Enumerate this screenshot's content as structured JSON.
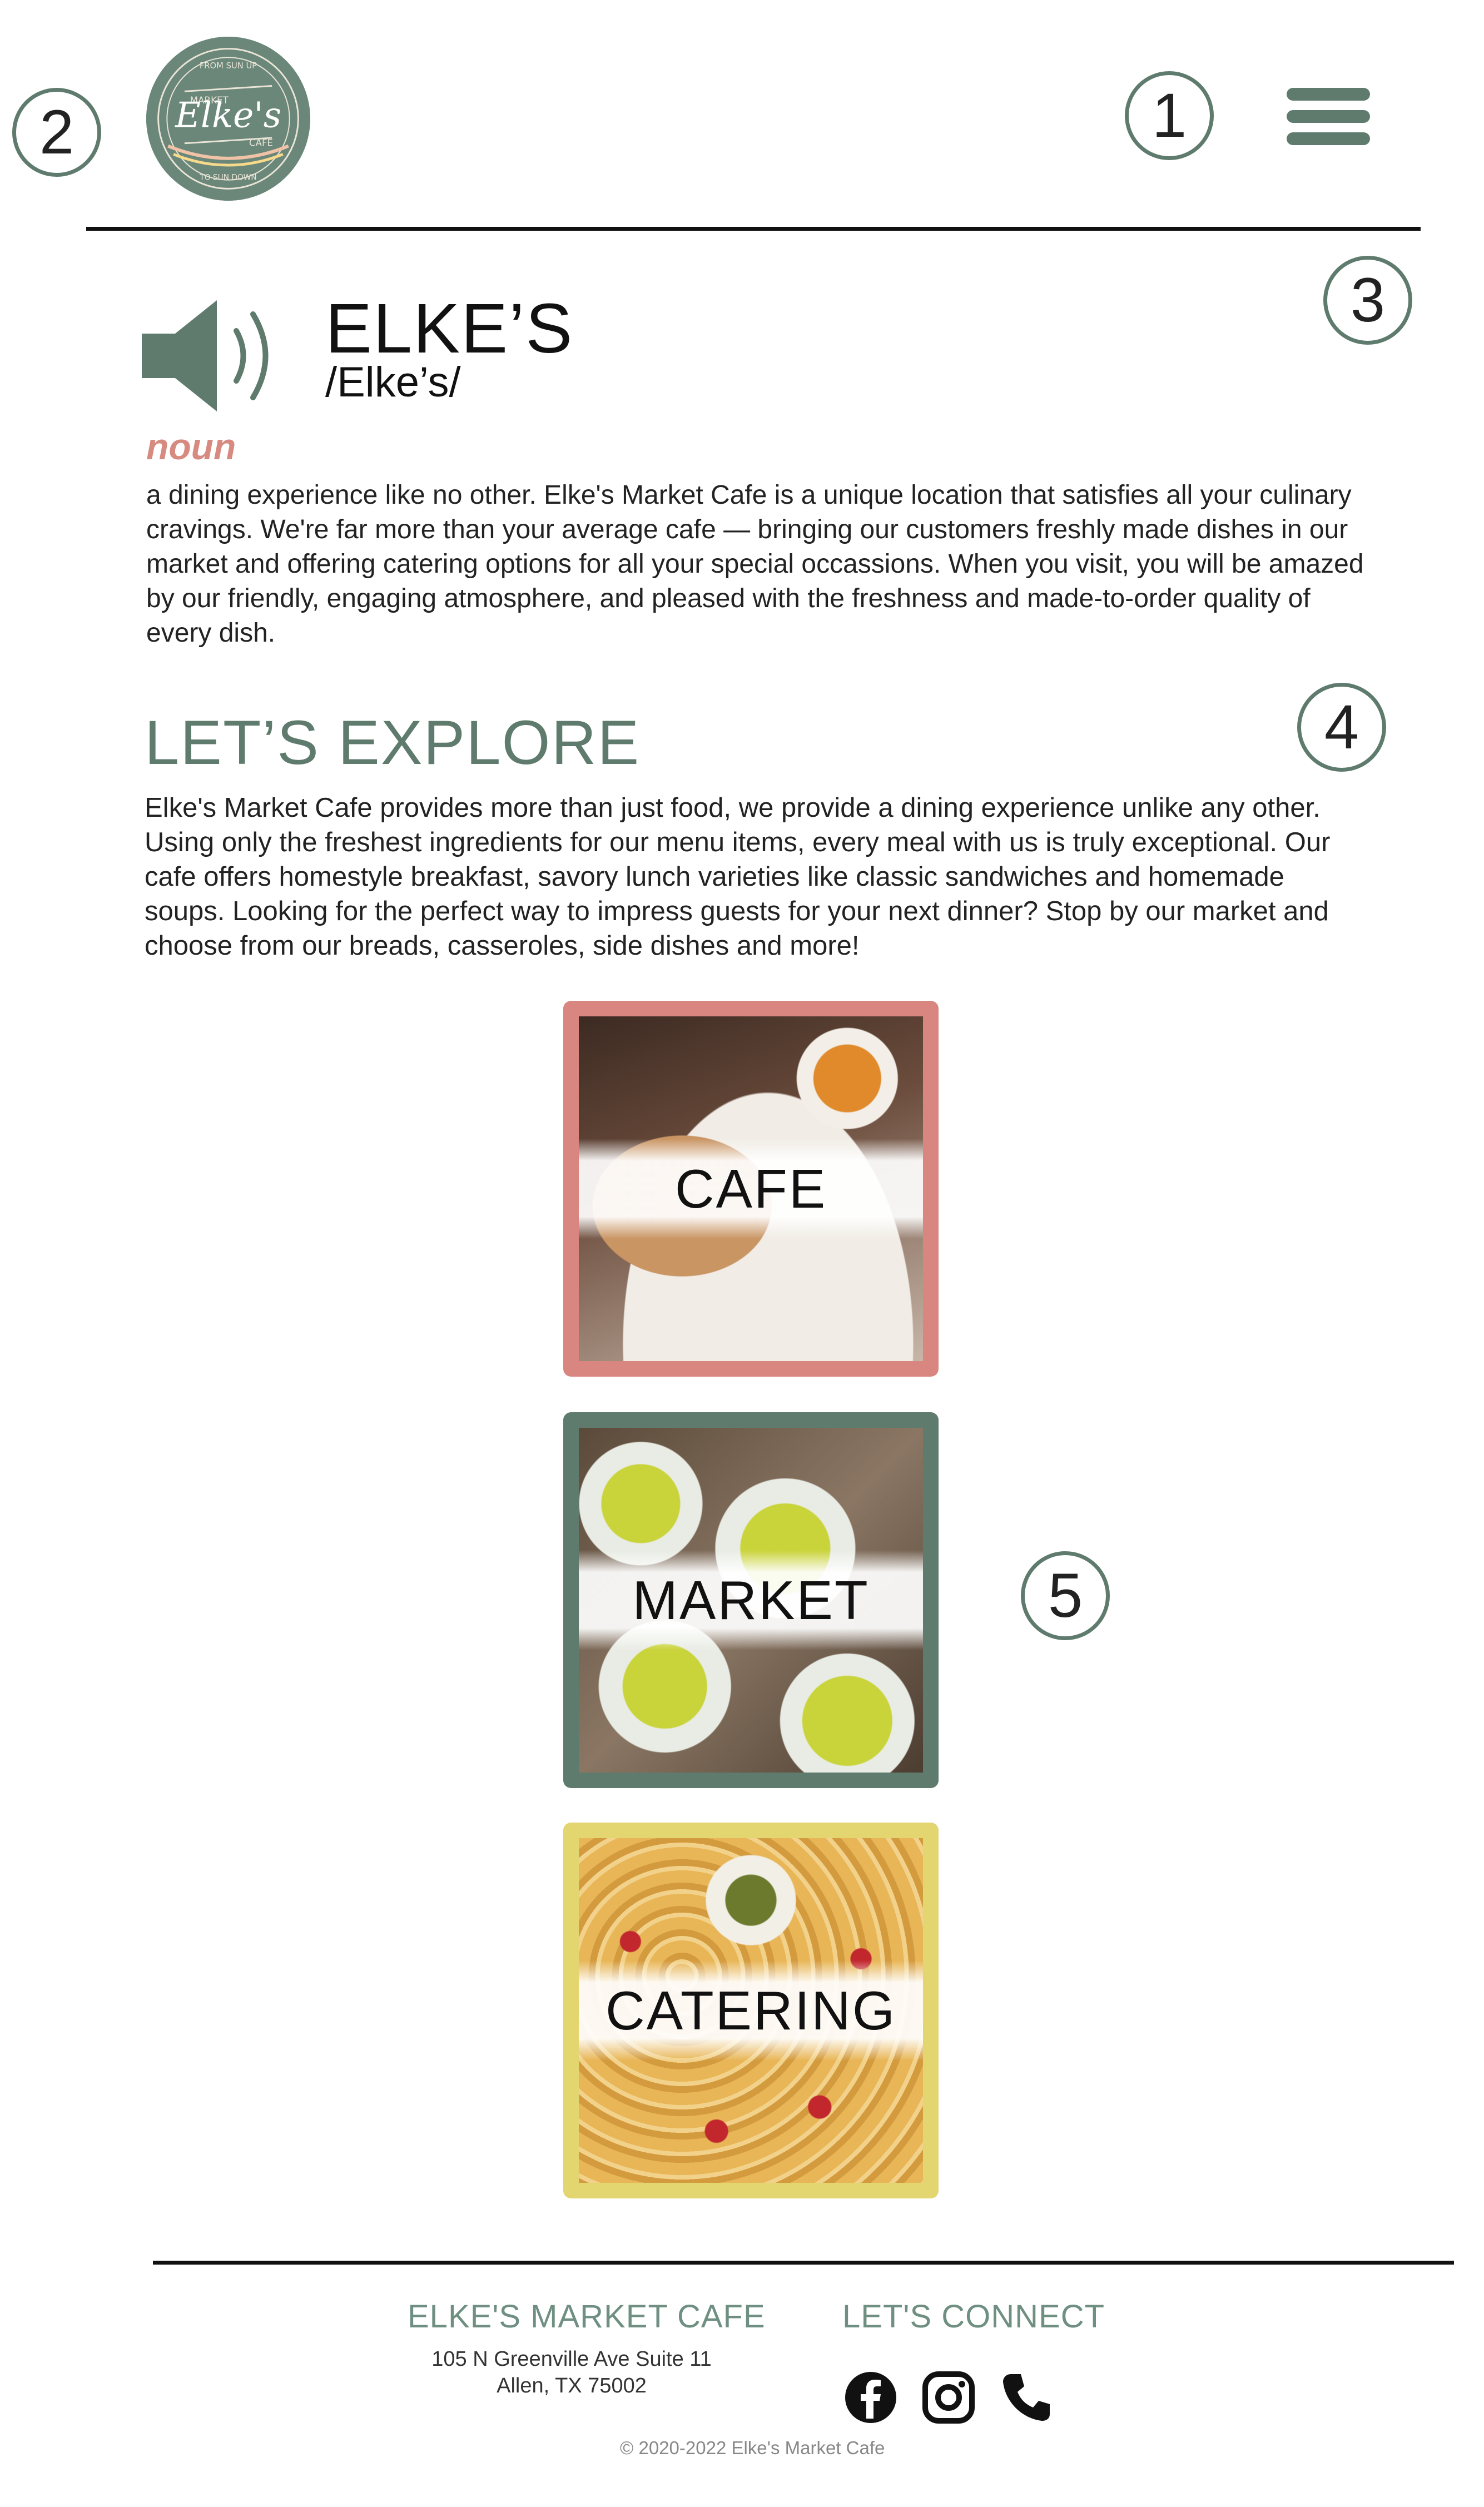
{
  "header": {
    "logo_alt": "Elke's Market Cafe logo",
    "logo_text": {
      "top_arc": "FROM SUN UP",
      "left": "MARKET",
      "center": "Elke's",
      "right": "CAFE",
      "bottom_arc": "TO SUN DOWN"
    },
    "menu_icon": "hamburger-menu-icon"
  },
  "callouts": [
    "1",
    "2",
    "3",
    "4",
    "5"
  ],
  "definition": {
    "speaker_icon": "speaker-icon",
    "word": "ELKE’S",
    "phonetic": "/Elke’s/",
    "part_of_speech": "noun",
    "text": "a dining experience like no other. Elke's Market Cafe is a unique location that satisfies all your culinary cravings. We're far more than your average cafe — bringing our customers freshly made dishes in our market and offering catering options for all your special occassions. When you visit, you will be amazed by our friendly, engaging atmosphere, and pleased with the freshness and made-to-order quality of every dish."
  },
  "explore": {
    "heading": "LET’S EXPLORE",
    "text": "Elke's Market Cafe provides more than just food, we provide a dining experience unlike any other. Using only the freshest ingredients for our menu items, every meal with us is truly exceptional. Our cafe offers homestyle breakfast, savory lunch varieties like classic sandwiches and homemade soups. Looking for the perfect way to impress guests for your next dinner? Stop by our market and choose from our breads, casseroles, side dishes and more!"
  },
  "cards": [
    {
      "label": "CAFE",
      "border_color": "#d98580"
    },
    {
      "label": "MARKET",
      "border_color": "#5f7b6e"
    },
    {
      "label": "CATERING",
      "border_color": "#e3d56f"
    }
  ],
  "footer": {
    "brand_heading": "ELKE'S MARKET CAFE",
    "address_line1": "105 N Greenville Ave Suite 11",
    "address_line2": "Allen, TX 75002",
    "connect_heading": "LET'S CONNECT",
    "social_icons": [
      "facebook-icon",
      "instagram-icon",
      "phone-icon"
    ],
    "copyright": "© 2020-2022 Elke's Market Cafe"
  },
  "colors": {
    "accent_green": "#5f7b6e",
    "accent_pink": "#d98580",
    "accent_yellow": "#e3d56f"
  }
}
